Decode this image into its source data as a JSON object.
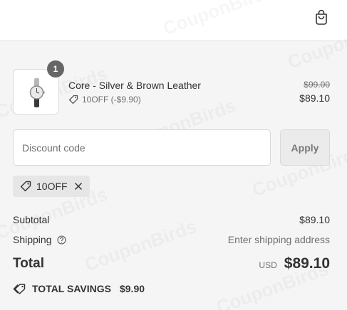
{
  "cart": {
    "item": {
      "quantity": "1",
      "name": "Core - Silver & Brown Leather",
      "discount": "10OFF (-$9.90)",
      "original_price": "$99.00",
      "price": "$89.10"
    }
  },
  "discount": {
    "placeholder": "Discount code",
    "value": "",
    "apply_label": "Apply",
    "applied_code": "10OFF"
  },
  "summary": {
    "subtotal_label": "Subtotal",
    "subtotal_value": "$89.10",
    "shipping_label": "Shipping",
    "shipping_value": "Enter shipping address",
    "total_label": "Total",
    "currency": "USD",
    "total_value": "$89.10",
    "savings_label": "TOTAL SAVINGS",
    "savings_value": "$9.90"
  },
  "watermark": "CouponBirds",
  "icons": {
    "bag": "shopping-bag-icon",
    "tag": "tag-icon",
    "remove": "close-icon",
    "help": "question-circle-icon"
  },
  "colors": {
    "background": "#f5f5f5",
    "header": "#ffffff",
    "text": "#333333",
    "muted": "#707070",
    "badge": "#666666"
  }
}
